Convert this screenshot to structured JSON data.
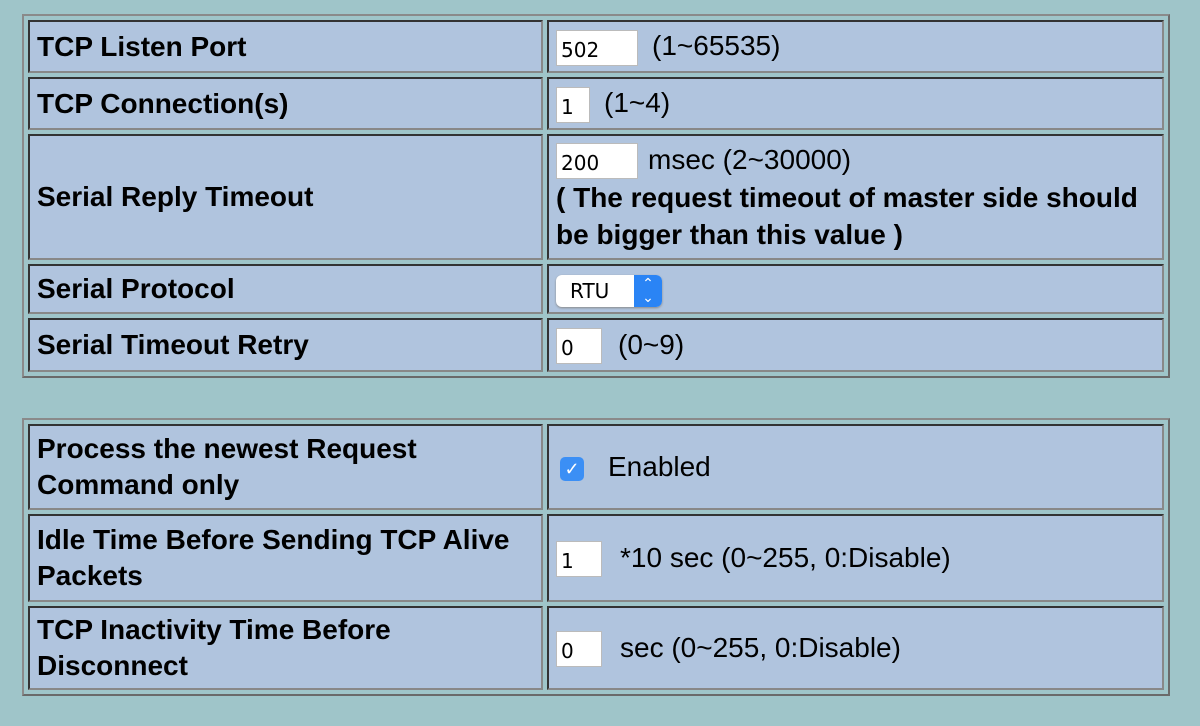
{
  "table1": [
    {
      "label": "TCP Listen Port",
      "value": "502",
      "hint": "(1~65535)"
    },
    {
      "label": "TCP Connection(s)",
      "value": "1",
      "hint": "(1~4)"
    },
    {
      "label": "Serial Reply Timeout",
      "value": "200",
      "hint": "msec (2~30000)",
      "note": "( The request timeout of master side should be bigger than this value )"
    },
    {
      "label": "Serial Protocol",
      "value": "RTU"
    },
    {
      "label": "Serial Timeout Retry",
      "value": "0",
      "hint": "(0~9)"
    }
  ],
  "table2": [
    {
      "label": "Process the newest Request Command only",
      "checked": true,
      "hint": "Enabled"
    },
    {
      "label": "Idle Time Before Sending TCP Alive Packets",
      "value": "1",
      "hint": "*10 sec (0~255, 0:Disable)"
    },
    {
      "label": "TCP Inactivity Time Before Disconnect",
      "value": "0",
      "hint": "sec (0~255, 0:Disable)"
    }
  ],
  "colors": {
    "background": "#9fc5c9",
    "cell": "#b0c4de",
    "accent": "#3b8ff5"
  }
}
